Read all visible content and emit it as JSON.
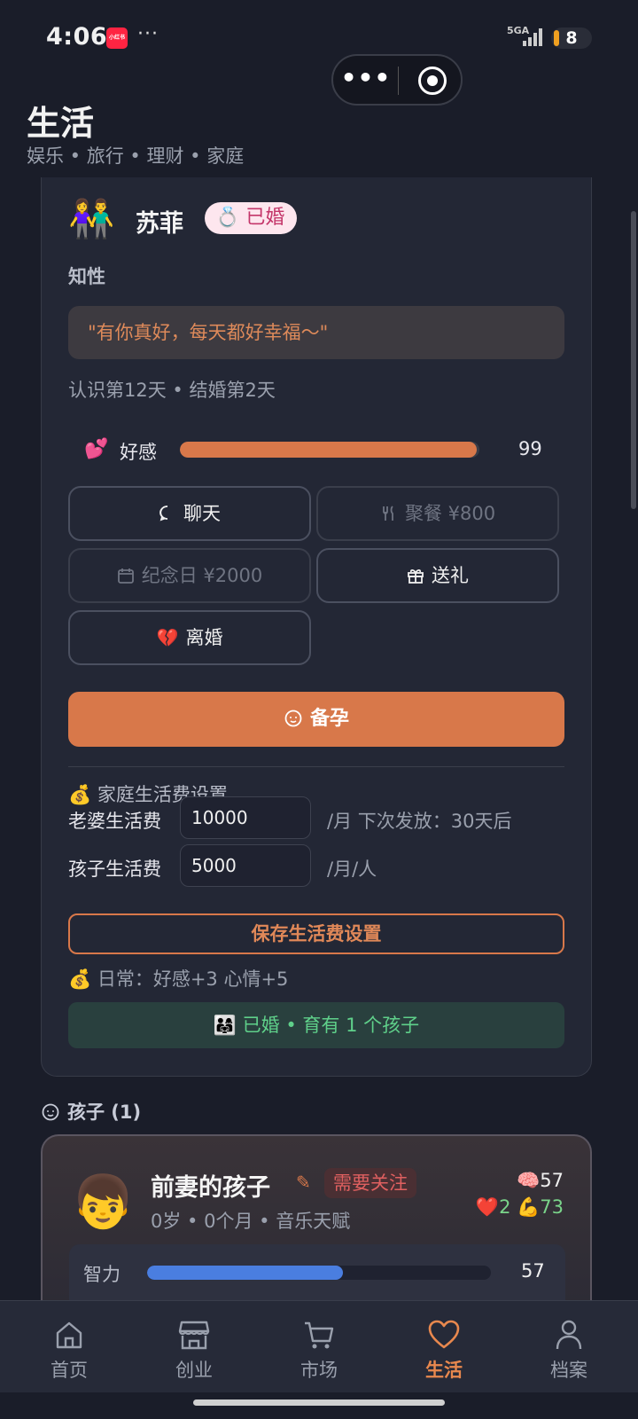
{
  "status_bar": {
    "time": "4:06",
    "app_badge": "小红书",
    "dots": "···",
    "network": "5G",
    "battery": "8"
  },
  "header": {
    "title": "生活",
    "subtitle": "娱乐 • 旅行 • 理财 • 家庭"
  },
  "spouse": {
    "avatar": "👫",
    "name": "苏菲",
    "badge": "💍 已婚",
    "personality": "知性",
    "quote": "\"有你真好，每天都好幸福～\"",
    "meta": "认识第12天 • 结婚第2天",
    "affection": {
      "icon": "💕",
      "label": "好感",
      "value": "99",
      "fraction": 0.99
    },
    "actions": {
      "chat": "聊天",
      "dinner": "聚餐 ¥800",
      "anniversary": "纪念日 ¥2000",
      "gift": "送礼",
      "divorce": "离婚",
      "prepare_baby": "备孕"
    },
    "living_expense": {
      "section_title": "💰 家庭生活费设置",
      "wife_label": "老婆生活费",
      "wife_value": "10000",
      "wife_unit": "/月  下次发放：30天后",
      "child_label": "孩子生活费",
      "child_value": "5000",
      "child_unit": "/月/人",
      "save_label": "保存生活费设置",
      "daily": "💰 日常：好感+3 心情+5"
    },
    "status": "👨‍👩‍👧 已婚 • 育有 1 个孩子"
  },
  "children": {
    "header": "孩子 (1)",
    "items": [
      {
        "avatar": "👦",
        "name": "前妻的孩子",
        "attention": "需要关注",
        "meta": "0岁 • 0个月 • 音乐天赋",
        "intelligence_top": "🧠57",
        "health": "❤️2",
        "strength": "💪73",
        "stat_label": "智力",
        "stat_value": "57",
        "stat_fraction": 0.57
      }
    ]
  },
  "tabbar": {
    "tabs": [
      {
        "label": "首页",
        "icon": "home-icon"
      },
      {
        "label": "创业",
        "icon": "store-icon"
      },
      {
        "label": "市场",
        "icon": "cart-icon"
      },
      {
        "label": "生活",
        "icon": "heart-icon",
        "active": true
      },
      {
        "label": "档案",
        "icon": "profile-icon"
      }
    ]
  },
  "colors": {
    "accent": "#d8784a",
    "background": "#1a1d29",
    "card": "#232735",
    "success": "#5fd08a",
    "info": "#4a7ee0"
  }
}
